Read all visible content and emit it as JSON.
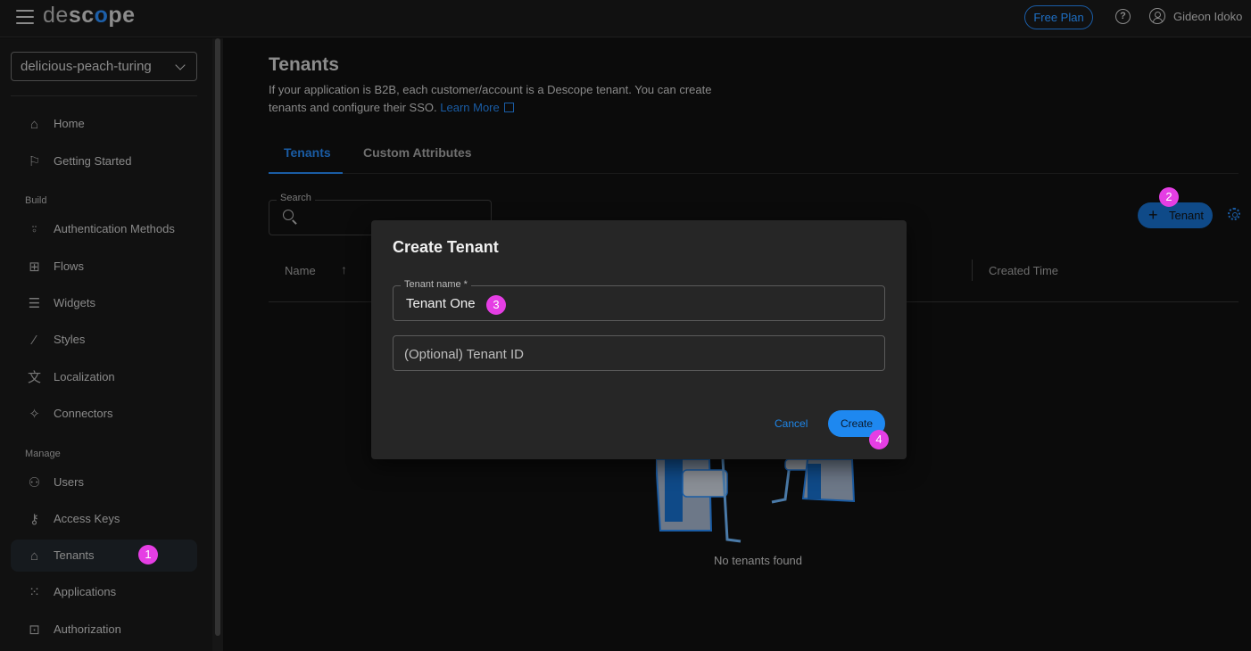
{
  "topbar": {
    "logo": {
      "pre": "de",
      "bold1": "sc",
      "o": "o",
      "bold2": "pe"
    },
    "free_plan_label": "Free Plan",
    "user_name": "Gideon Idoko"
  },
  "sidebar": {
    "project": "delicious-peach-turing",
    "items_top": [
      {
        "label": "Home",
        "icon": "home-icon"
      },
      {
        "label": "Getting Started",
        "icon": "flag-icon"
      }
    ],
    "section_build": "Build",
    "items_build": [
      {
        "label": "Authentication Methods",
        "icon": "user-check-icon"
      },
      {
        "label": "Flows",
        "icon": "flow-icon"
      },
      {
        "label": "Widgets",
        "icon": "widgets-icon"
      },
      {
        "label": "Styles",
        "icon": "brush-icon"
      },
      {
        "label": "Localization",
        "icon": "translate-icon"
      },
      {
        "label": "Connectors",
        "icon": "puzzle-icon"
      }
    ],
    "section_manage": "Manage",
    "items_manage": [
      {
        "label": "Users",
        "icon": "users-icon"
      },
      {
        "label": "Access Keys",
        "icon": "key-icon"
      },
      {
        "label": "Tenants",
        "icon": "tenants-icon",
        "active": true
      },
      {
        "label": "Applications",
        "icon": "apps-grid-icon"
      },
      {
        "label": "Authorization",
        "icon": "lock-icon"
      }
    ]
  },
  "main": {
    "title": "Tenants",
    "description": "If your application is B2B, each customer/account is a Descope tenant. You can create tenants and configure their SSO.",
    "learn_more": "Learn More",
    "tabs": [
      {
        "label": "Tenants",
        "active": true
      },
      {
        "label": "Custom Attributes",
        "active": false
      }
    ],
    "search_label": "Search",
    "search_value": "",
    "add_button_label": "Tenant",
    "columns": [
      "Name",
      "Created Time"
    ],
    "empty_text": "No tenants found"
  },
  "dialog": {
    "title": "Create Tenant",
    "name_label": "Tenant name *",
    "name_value": "Tenant One",
    "id_placeholder": "(Optional) Tenant ID",
    "cancel_label": "Cancel",
    "create_label": "Create"
  },
  "annotations": [
    "1",
    "2",
    "3",
    "4"
  ],
  "colors": {
    "accent": "#1e88f0",
    "accent_dim": "#1a5ca4",
    "badge": "#e53ee4"
  }
}
